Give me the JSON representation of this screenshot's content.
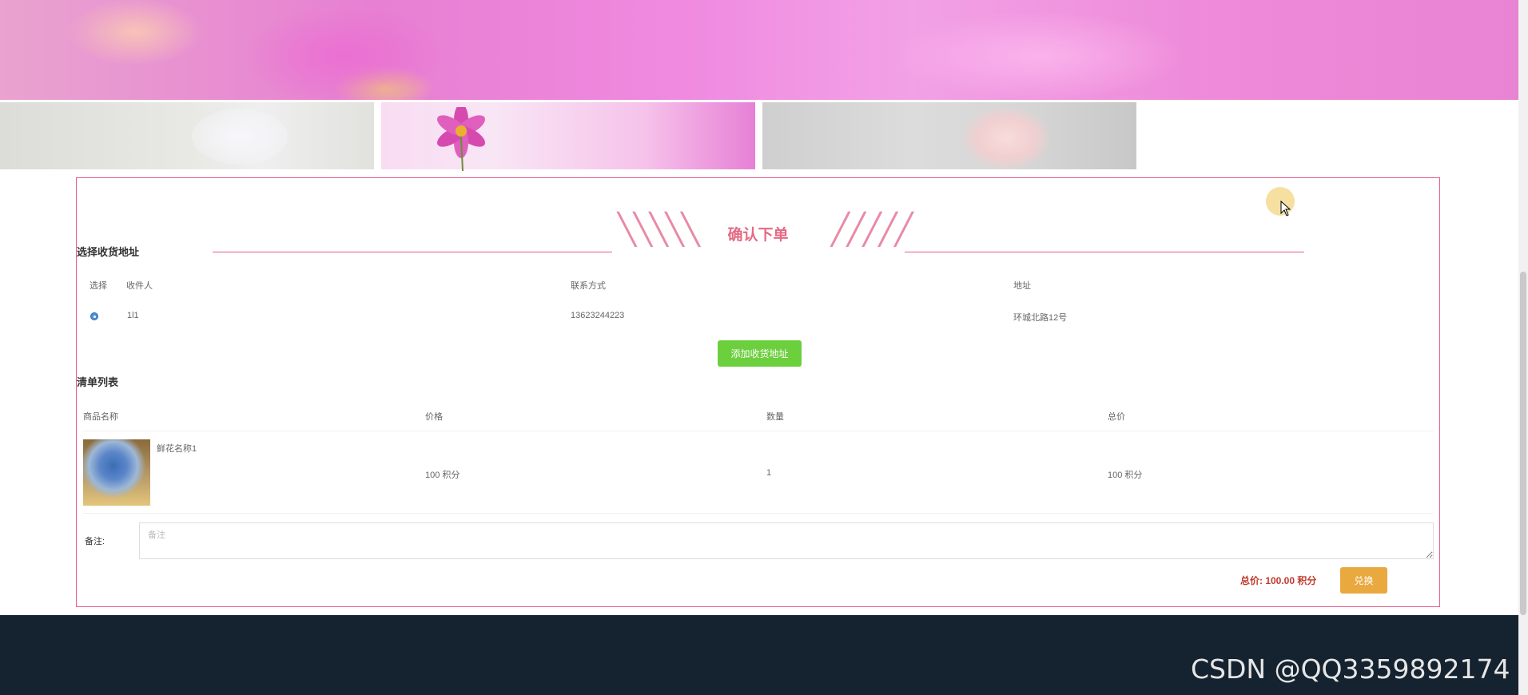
{
  "order": {
    "title": "确认下单",
    "address_section": {
      "title": "选择收货地址",
      "headers": [
        "选择",
        "收件人",
        "联系方式",
        "地址"
      ],
      "rows": [
        {
          "recipient": "1l1",
          "phone": "13623244223",
          "address": "环城北路12号",
          "selected": true
        }
      ],
      "add_button": "添加收货地址"
    },
    "list_section": {
      "title": "清单列表",
      "headers": [
        "商品名称",
        "价格",
        "数量",
        "总价"
      ],
      "items": [
        {
          "name": "鲜花名称1",
          "price": "100 积分",
          "quantity": "1",
          "total": "100 积分"
        }
      ]
    },
    "remark": {
      "label": "备注:",
      "placeholder": "备注"
    },
    "summary": {
      "total_text": "总价: 100.00 积分"
    },
    "pay_button": "兑换"
  },
  "watermark": "CSDN @QQ3359892174",
  "colors": {
    "accent": "#e55c8a",
    "add_button": "#6ccf3e",
    "pay_button": "#e9a93f",
    "total_text": "#c0392b",
    "footer": "#15222f"
  }
}
